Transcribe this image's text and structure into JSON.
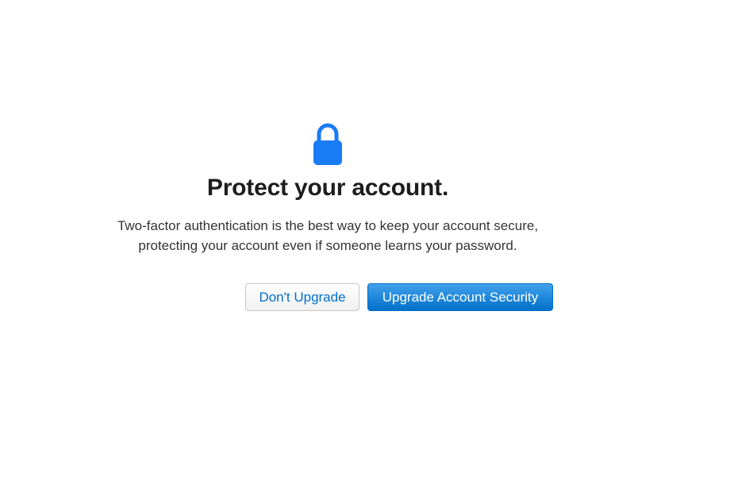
{
  "icon": {
    "name": "lock-icon",
    "color": "#1a7cf5"
  },
  "heading": "Protect your account.",
  "description": {
    "line1": "Two-factor authentication is the best way to keep your account secure,",
    "line2": "protecting your account even if someone learns your password."
  },
  "buttons": {
    "secondary_label": "Don't Upgrade",
    "primary_label": "Upgrade Account Security"
  },
  "colors": {
    "accent": "#0070c9",
    "primary_button_top": "#42a1ec",
    "primary_button_bottom": "#0070c9"
  }
}
